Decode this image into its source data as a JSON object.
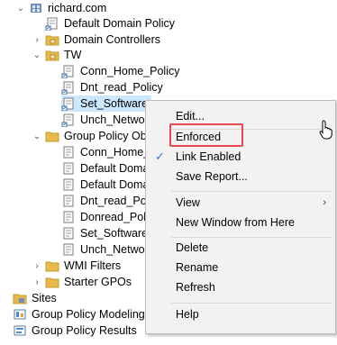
{
  "tree": {
    "items": [
      {
        "label": "richard.com",
        "icon": "domain-icon"
      },
      {
        "label": "Default Domain Policy",
        "icon": "gpo-link-icon"
      },
      {
        "label": "Domain Controllers",
        "icon": "ou-folder-icon"
      },
      {
        "label": "TW",
        "icon": "ou-folder-icon"
      },
      {
        "label": "Conn_Home_Policy",
        "icon": "gpo-link-icon"
      },
      {
        "label": "Dnt_read_Policy",
        "icon": "gpo-link-icon"
      },
      {
        "label": "Set_Software",
        "icon": "gpo-link-icon"
      },
      {
        "label": "Unch_Netwo",
        "icon": "gpo-link-icon"
      },
      {
        "label": "Group Policy Ob",
        "icon": "folder-icon"
      },
      {
        "label": "Conn_Home_",
        "icon": "gpo-icon"
      },
      {
        "label": "Default Doma",
        "icon": "gpo-icon"
      },
      {
        "label": "Default Doma",
        "icon": "gpo-icon"
      },
      {
        "label": "Dnt_read_Pol",
        "icon": "gpo-icon"
      },
      {
        "label": "Donread_Poli",
        "icon": "gpo-icon"
      },
      {
        "label": "Set_Software",
        "icon": "gpo-icon"
      },
      {
        "label": "Unch_Netwo",
        "icon": "gpo-icon"
      },
      {
        "label": "WMI Filters",
        "icon": "folder-icon"
      },
      {
        "label": "Starter GPOs",
        "icon": "folder-icon"
      },
      {
        "label": "Sites",
        "icon": "sites-icon"
      },
      {
        "label": "Group Policy Modeling",
        "icon": "modeling-icon"
      },
      {
        "label": "Group Policy Results",
        "icon": "results-icon"
      }
    ]
  },
  "context_menu": {
    "edit": "Edit...",
    "enforced": "Enforced",
    "link_enabled": "Link Enabled",
    "link_enabled_checked": true,
    "save_report": "Save Report...",
    "view": "View",
    "new_window": "New Window from Here",
    "delete": "Delete",
    "rename": "Rename",
    "refresh": "Refresh",
    "help": "Help"
  },
  "colors": {
    "selection": "#cce8ff",
    "highlight_border": "#e8484f",
    "menu_bg": "#f2f2f2",
    "folder": "#e8b94a",
    "check": "#2b79d4"
  }
}
